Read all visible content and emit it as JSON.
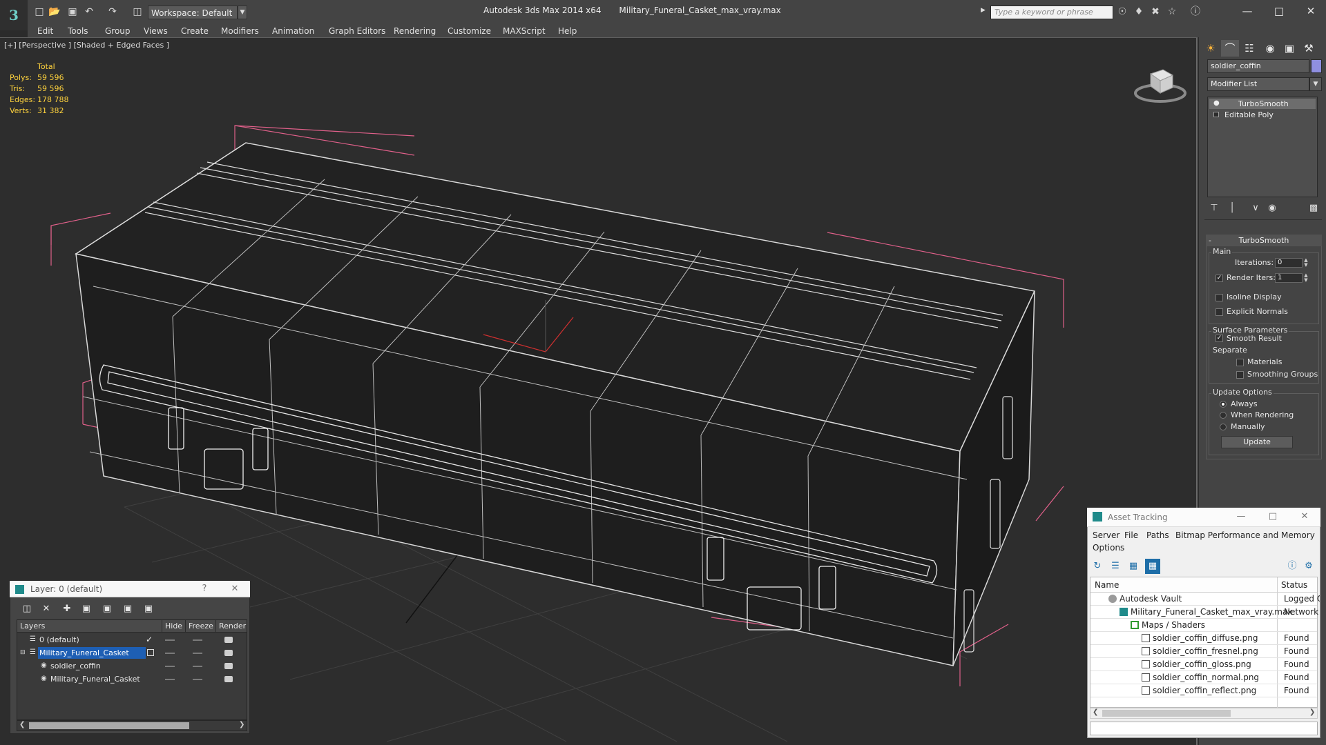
{
  "title_bar": {
    "app_name": "Autodesk 3ds Max  2014 x64",
    "file_name": "Military_Funeral_Casket_max_vray.max",
    "workspace": "Workspace: Default",
    "search_placeholder": "Type a keyword or phrase"
  },
  "menu": [
    "Edit",
    "Tools",
    "Group",
    "Views",
    "Create",
    "Modifiers",
    "Animation",
    "Graph Editors",
    "Rendering",
    "Customize",
    "MAXScript",
    "Help"
  ],
  "viewport": {
    "label": "[+] [Perspective ] [Shaded + Edged Faces ]",
    "stats": {
      "header": "Total",
      "rows": [
        {
          "label": "Polys:",
          "value": "59 596"
        },
        {
          "label": "Tris:",
          "value": "59 596"
        },
        {
          "label": "Edges:",
          "value": "178 788"
        },
        {
          "label": "Verts:",
          "value": "31 382"
        }
      ]
    }
  },
  "command_panel": {
    "object_name": "soldier_coffin",
    "object_color": "#8f8fe0",
    "modifier_list_label": "Modifier List",
    "stack": [
      "TurboSmooth",
      "Editable Poly"
    ],
    "rollout_title": "TurboSmooth",
    "main_group": "Main",
    "iterations_label": "Iterations:",
    "iterations_value": "0",
    "render_iters_label": "Render Iters:",
    "render_iters_value": "1",
    "render_iters_checked": true,
    "isoline_label": "Isoline Display",
    "explicit_normals_label": "Explicit Normals",
    "surface_group": "Surface Parameters",
    "smooth_result_label": "Smooth Result",
    "separate_label": "Separate",
    "materials_label": "Materials",
    "smoothing_groups_label": "Smoothing Groups",
    "update_group": "Update Options",
    "update_options": [
      "Always",
      "When Rendering",
      "Manually"
    ],
    "update_selected": "Always",
    "update_button": "Update"
  },
  "asset_tracking": {
    "title": "Asset Tracking",
    "menu": [
      "Server",
      "File",
      "Paths",
      "Bitmap Performance and Memory",
      "Options"
    ],
    "columns": {
      "name": "Name",
      "status": "Status"
    },
    "rows": [
      {
        "name": "Autodesk Vault",
        "status": "Logged O"
      },
      {
        "name": "Military_Funeral_Casket_max_vray.max",
        "status": "Network F"
      },
      {
        "name": "Maps / Shaders",
        "status": ""
      },
      {
        "name": "soldier_coffin_diffuse.png",
        "status": "Found"
      },
      {
        "name": "soldier_coffin_fresnel.png",
        "status": "Found"
      },
      {
        "name": "soldier_coffin_gloss.png",
        "status": "Found"
      },
      {
        "name": "soldier_coffin_normal.png",
        "status": "Found"
      },
      {
        "name": "soldier_coffin_reflect.png",
        "status": "Found"
      }
    ]
  },
  "layer_window": {
    "title": "Layer: 0 (default)",
    "help": "?",
    "columns": {
      "layers": "Layers",
      "hide": "Hide",
      "freeze": "Freeze",
      "render": "Render"
    },
    "rows": [
      {
        "name": "0 (default)"
      },
      {
        "name": "Military_Funeral_Casket"
      },
      {
        "name": "soldier_coffin"
      },
      {
        "name": "Military_Funeral_Casket"
      }
    ]
  }
}
